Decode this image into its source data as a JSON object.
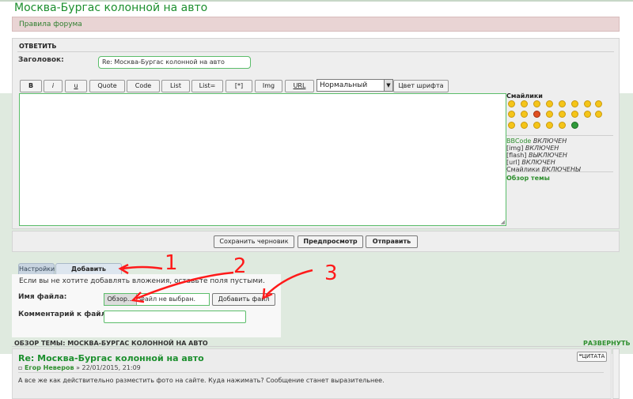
{
  "page_title": "Москва-Бургас колонной на авто",
  "rules_link": "Правила форума",
  "reply": {
    "header": "ОТВЕТИТЬ",
    "subject_label": "Заголовок:",
    "subject_value": "Re: Москва-Бургас колонной на авто"
  },
  "toolbar": {
    "buttons": [
      "B",
      "i",
      "u",
      "Quote",
      "Code",
      "List",
      "List=",
      "[*]",
      "Img",
      "URL"
    ],
    "font_size": "Нормальный",
    "font_color": "Цвет шрифта"
  },
  "smilies": {
    "header": "Смайлики",
    "status": [
      {
        "name": "BBCode",
        "state": "ВКЛЮЧЕН"
      },
      {
        "name": "[img]",
        "state": "ВКЛЮЧЕН"
      },
      {
        "name": "[flash]",
        "state": "ВЫКЛЮЧЕН"
      },
      {
        "name": "[url]",
        "state": "ВКЛЮЧЕН"
      },
      {
        "name": "Смайлики",
        "state": "ВКЛЮЧЕНЫ"
      }
    ],
    "topic_review_link": "Обзор темы"
  },
  "actions": {
    "save_draft": "Сохранить черновик",
    "preview": "Предпросмотр",
    "submit": "Отправить"
  },
  "tabs": {
    "options": "Настройки",
    "attachments": "Добавить вложения"
  },
  "attachments": {
    "note": "Если вы не хотите добавлять вложения, оставьте поля пустыми.",
    "file_label": "Имя файла:",
    "browse": "Обзор...",
    "no_file": "Файл не выбран.",
    "add_file": "Добавить файл",
    "comment_label": "Комментарий к файлу:"
  },
  "review": {
    "title": "ОБЗОР ТЕМЫ: МОСКВА-БУРГАС КОЛОННОЙ НА АВТО",
    "expand": "РАЗВЕРНУТЬ",
    "post_title": "Re: Москва-Бургас колонной на авто",
    "author": "Егор Неверов",
    "date": "» 22/01/2015, 21:09",
    "quote": "ЦИТАТА",
    "text": "А все же как действительно разместить фото на сайте. Куда нажимать? Сообщение станет выразительнее."
  },
  "annotations": [
    "1",
    "2",
    "3"
  ],
  "colors": {
    "accent_green": "#1c8f2e",
    "rules_bg": "#e9d4d4",
    "annotation_red": "#ff1a1a"
  }
}
